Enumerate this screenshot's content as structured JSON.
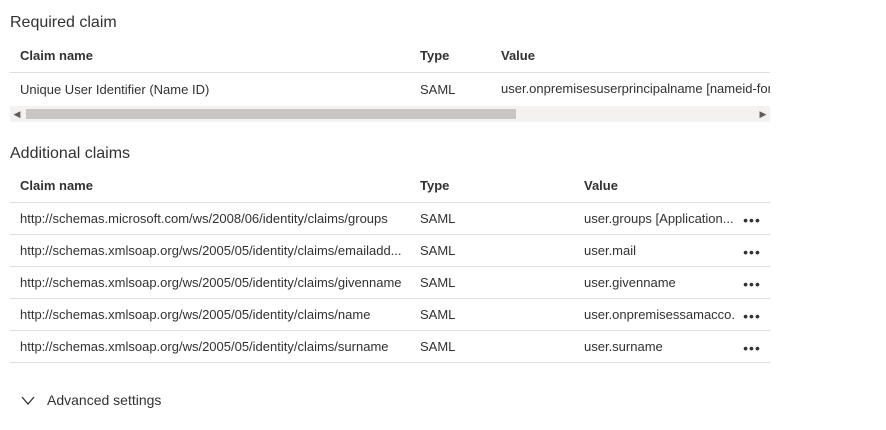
{
  "required": {
    "title": "Required claim",
    "columns": {
      "claim_name": "Claim name",
      "type": "Type",
      "value": "Value"
    },
    "rows": [
      {
        "name": "Unique User Identifier (Name ID)",
        "type": "SAML",
        "value": "user.onpremisesuserprincipalname [nameid-for"
      }
    ]
  },
  "additional": {
    "title": "Additional claims",
    "columns": {
      "claim_name": "Claim name",
      "type": "Type",
      "value": "Value"
    },
    "rows": [
      {
        "name": "http://schemas.microsoft.com/ws/2008/06/identity/claims/groups",
        "type": "SAML",
        "value": "user.groups [Application..."
      },
      {
        "name": "http://schemas.xmlsoap.org/ws/2005/05/identity/claims/emailadd...",
        "type": "SAML",
        "value": "user.mail"
      },
      {
        "name": "http://schemas.xmlsoap.org/ws/2005/05/identity/claims/givenname",
        "type": "SAML",
        "value": "user.givenname"
      },
      {
        "name": "http://schemas.xmlsoap.org/ws/2005/05/identity/claims/name",
        "type": "SAML",
        "value": "user.onpremisessamacco..."
      },
      {
        "name": "http://schemas.xmlsoap.org/ws/2005/05/identity/claims/surname",
        "type": "SAML",
        "value": "user.surname"
      }
    ],
    "more_icon": "more-horizontal-icon",
    "more_glyph": "•••"
  },
  "advanced": {
    "label": "Advanced settings",
    "icon": "chevron-down-icon"
  },
  "scrollbar": {
    "left_arrow": "◀",
    "right_arrow": "▶"
  },
  "colors": {
    "divider": "#e1dfdd",
    "text": "#323130",
    "scroll_track": "#f3f2f1",
    "scroll_thumb": "#c8c6c4"
  }
}
